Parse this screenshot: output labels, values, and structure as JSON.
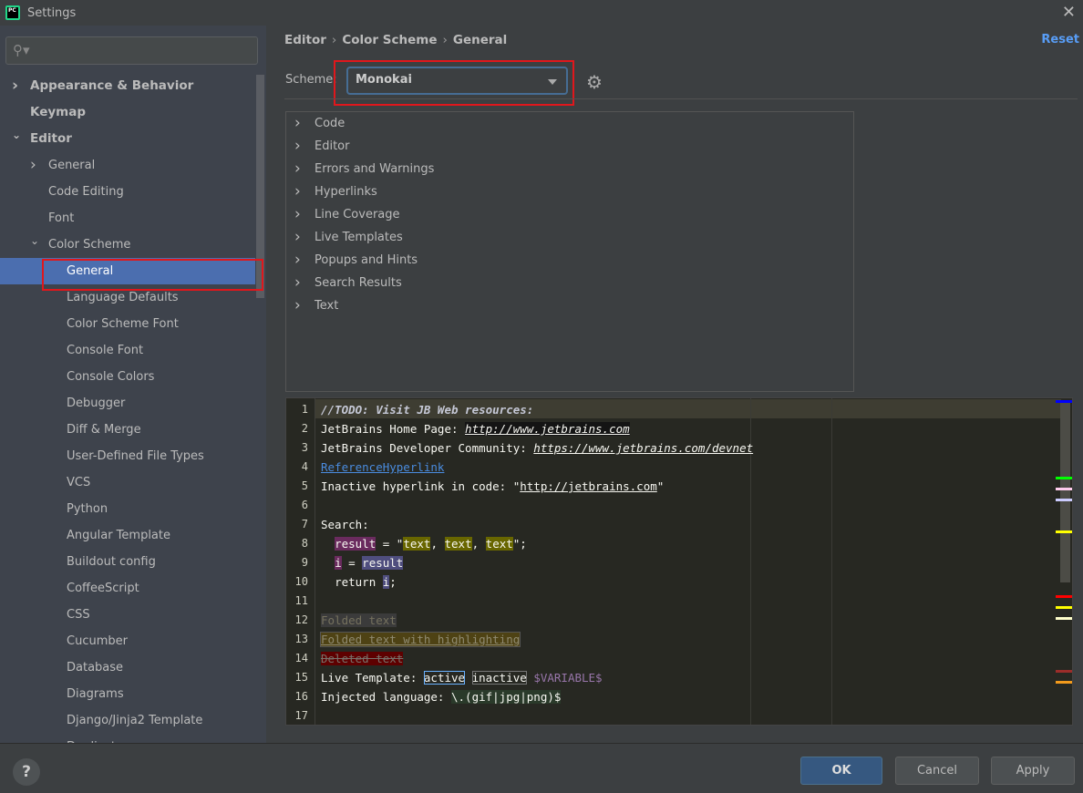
{
  "window": {
    "title": "Settings"
  },
  "search": {
    "placeholder": ""
  },
  "sidebar": {
    "items": [
      {
        "label": "Appearance & Behavior",
        "level": 0,
        "bold": true,
        "chevron": "right"
      },
      {
        "label": "Keymap",
        "level": 0,
        "bold": true,
        "chevron": ""
      },
      {
        "label": "Editor",
        "level": 0,
        "bold": true,
        "chevron": "down"
      },
      {
        "label": "General",
        "level": 1,
        "chevron": "right"
      },
      {
        "label": "Code Editing",
        "level": 1,
        "chevron": ""
      },
      {
        "label": "Font",
        "level": 1,
        "chevron": ""
      },
      {
        "label": "Color Scheme",
        "level": 1,
        "chevron": "down"
      },
      {
        "label": "General",
        "level": 2,
        "chevron": "",
        "selected": true
      },
      {
        "label": "Language Defaults",
        "level": 2
      },
      {
        "label": "Color Scheme Font",
        "level": 2
      },
      {
        "label": "Console Font",
        "level": 2
      },
      {
        "label": "Console Colors",
        "level": 2
      },
      {
        "label": "Debugger",
        "level": 2
      },
      {
        "label": "Diff & Merge",
        "level": 2
      },
      {
        "label": "User-Defined File Types",
        "level": 2
      },
      {
        "label": "VCS",
        "level": 2
      },
      {
        "label": "Python",
        "level": 2
      },
      {
        "label": "Angular Template",
        "level": 2
      },
      {
        "label": "Buildout config",
        "level": 2
      },
      {
        "label": "CoffeeScript",
        "level": 2
      },
      {
        "label": "CSS",
        "level": 2
      },
      {
        "label": "Cucumber",
        "level": 2
      },
      {
        "label": "Database",
        "level": 2
      },
      {
        "label": "Diagrams",
        "level": 2
      },
      {
        "label": "Django/Jinja2 Template",
        "level": 2
      },
      {
        "label": "Duplicates",
        "level": 2
      }
    ]
  },
  "breadcrumb": [
    "Editor",
    "Color Scheme",
    "General"
  ],
  "breadcrumb_sep": "›",
  "reset_label": "Reset",
  "scheme": {
    "label": "Scheme:",
    "value": "Monokai"
  },
  "categories": [
    "Code",
    "Editor",
    "Errors and Warnings",
    "Hyperlinks",
    "Line Coverage",
    "Live Templates",
    "Popups and Hints",
    "Search Results",
    "Text"
  ],
  "preview": {
    "lines": [
      [
        [
          "//TODO: Visit JB Web resources:",
          "todo"
        ]
      ],
      [
        [
          "JetBrains Home Page: ",
          ""
        ],
        [
          "http://www.jetbrains.com",
          "link2"
        ]
      ],
      [
        [
          "JetBrains Developer Community: ",
          ""
        ],
        [
          "https://www.jetbrains.com/devnet",
          "link"
        ]
      ],
      [
        [
          "ReferenceHyperlink",
          "ref"
        ]
      ],
      [
        [
          "Inactive hyperlink in code: \"",
          ""
        ],
        [
          "http://jetbrains.com",
          "inlink"
        ],
        [
          "\"",
          ""
        ]
      ],
      [],
      [
        [
          "Search:",
          ""
        ]
      ],
      [
        [
          "  ",
          "ws"
        ],
        [
          "result",
          "write"
        ],
        [
          " = \"",
          ""
        ],
        [
          "text",
          "find"
        ],
        [
          ", ",
          ""
        ],
        [
          "text",
          "find"
        ],
        [
          ", ",
          ""
        ],
        [
          "text",
          "find"
        ],
        [
          "\";",
          ""
        ]
      ],
      [
        [
          "  ",
          "ws"
        ],
        [
          "i",
          "write"
        ],
        [
          " = ",
          ""
        ],
        [
          "result",
          "read"
        ]
      ],
      [
        [
          "  ",
          "ws"
        ],
        [
          "return ",
          ""
        ],
        [
          "i",
          "read"
        ],
        [
          ";",
          ""
        ]
      ],
      [],
      [
        [
          "Folded text",
          "folded"
        ]
      ],
      [
        [
          "Folded text with highlighting",
          "foldhl"
        ]
      ],
      [
        [
          "Deleted text",
          "del"
        ]
      ],
      [
        [
          "Live Template: ",
          ""
        ],
        [
          "active",
          "active"
        ],
        [
          " ",
          ""
        ],
        [
          "inactive",
          "inactive"
        ],
        [
          " ",
          ""
        ],
        [
          "$VARIABLE$",
          "var"
        ]
      ],
      [
        [
          "Injected language: ",
          ""
        ],
        [
          "\\.(gif|jpg|png)$",
          "inj"
        ]
      ],
      []
    ],
    "stripe_marks": [
      "#0000ff",
      "#00ff00",
      "#ffccee",
      "#ccccff",
      "#ffff00",
      "#ff0000",
      "#ffff00",
      "#ffffcc",
      "#9b2d2a",
      "#f29a1c"
    ]
  },
  "buttons": {
    "ok": "OK",
    "cancel": "Cancel",
    "apply": "Apply",
    "help": "?"
  },
  "colors": {
    "accent": "#4b6eaf",
    "highlight_box": "#e0171c",
    "editor_bg": "#272822"
  }
}
